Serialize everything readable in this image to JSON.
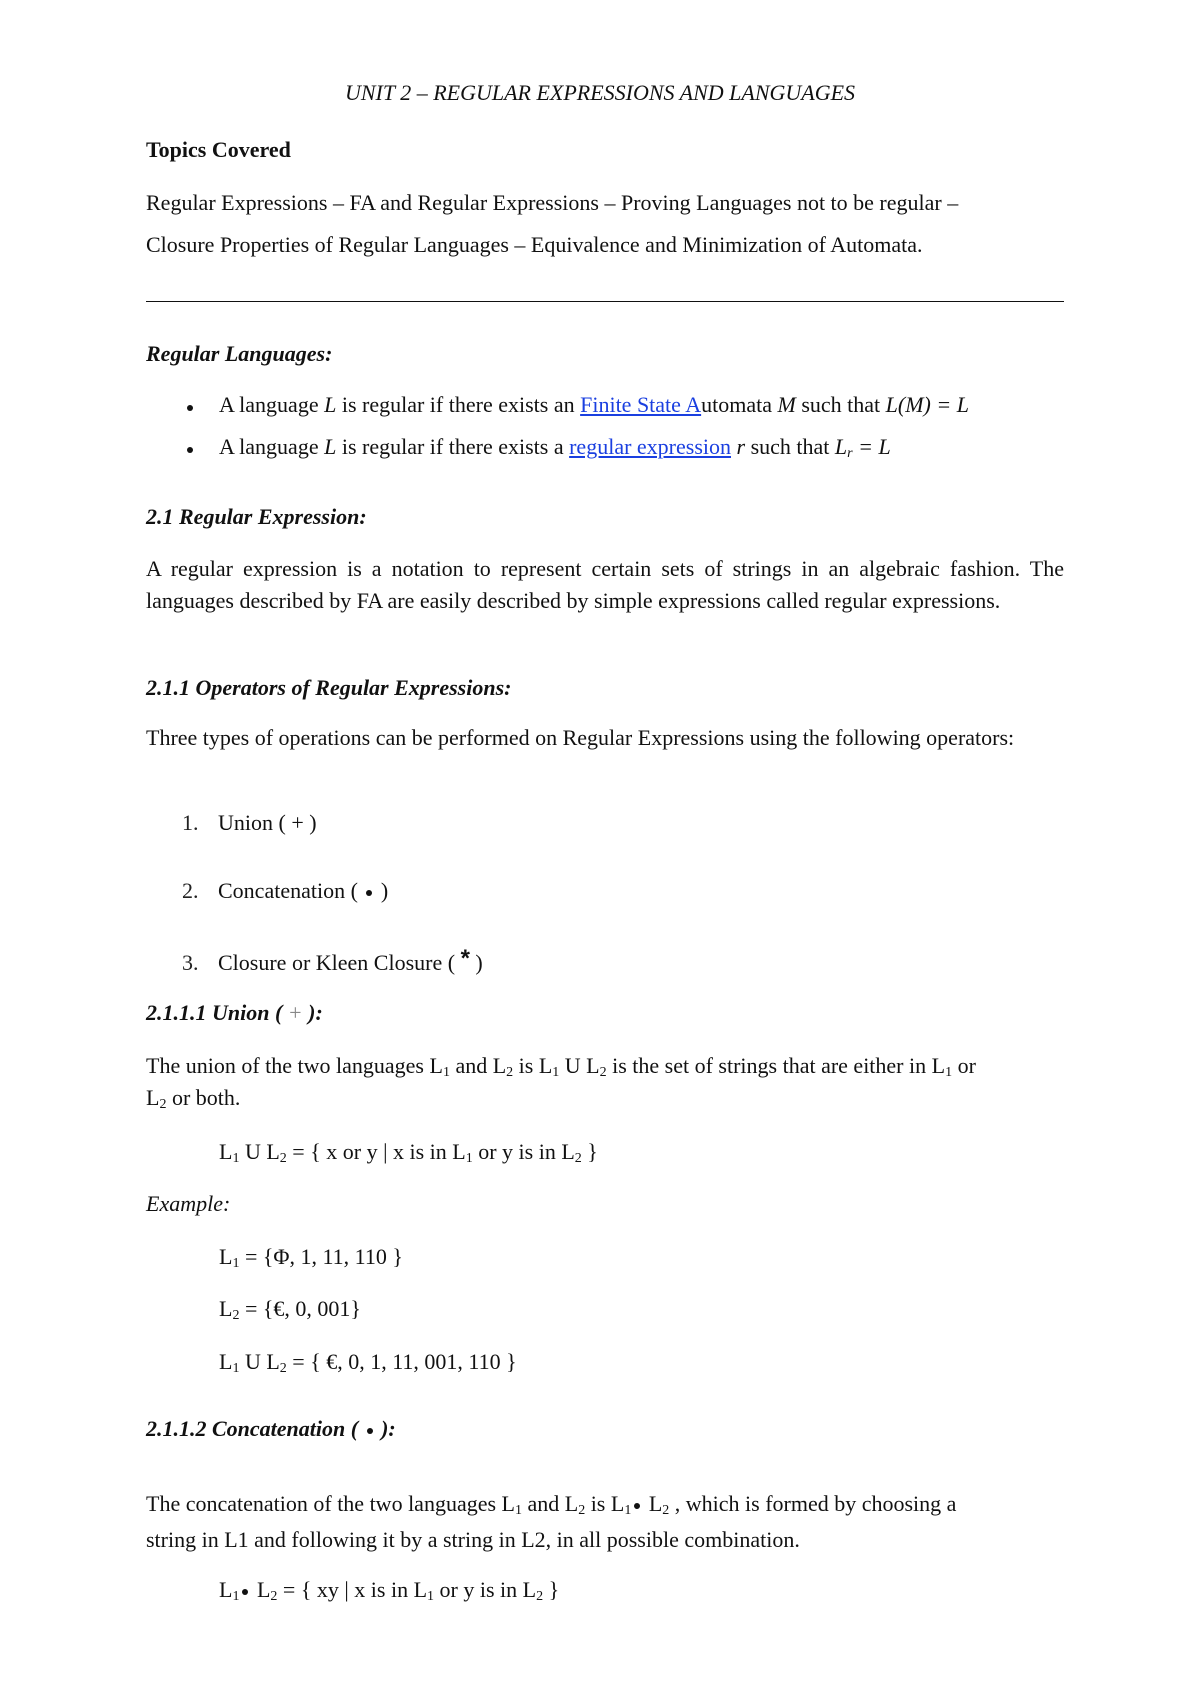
{
  "doc": {
    "title": "UNIT 2 – REGULAR EXPRESSIONS AND LANGUAGES",
    "topics_heading": "Topics Covered",
    "topics_line1": "Regular Expressions – FA and Regular Expressions – Proving Languages not to be regular –",
    "topics_line2": "Closure Properties of Regular Languages – Equivalence and Minimization of Automata.",
    "regular_languages": {
      "heading": "Regular Languages:",
      "bullet1": {
        "pre": "A language ",
        "L": "L",
        "mid": " is regular if there exists an ",
        "link": "Finite State A",
        "post": "utomata ",
        "M": "M",
        "tail": " such that ",
        "formula": "L(M) = L"
      },
      "bullet2": {
        "pre": "A language ",
        "L": "L",
        "mid": " is regular if there exists a ",
        "link": "regular expression",
        "post": " ",
        "r": "r",
        "tail": " such that ",
        "Lr": "L",
        "sub": "r",
        "eq": " = L"
      }
    },
    "section_2_1": {
      "heading": "2.1 Regular Expression:",
      "para": "A regular expression is a notation to represent certain sets of strings in an algebraic fashion. The languages described by FA are easily described by simple expressions called regular expressions."
    },
    "section_2_1_1": {
      "heading": "2.1.1 Operators of Regular Expressions:",
      "para": "Three types of operations can  be performed on Regular Expressions using the following operators:",
      "operators": [
        {
          "num": "1.",
          "label": "Union ( + )"
        },
        {
          "num": "2.",
          "label_pre": "Concatenation (",
          "label_post": ")"
        },
        {
          "num": "3.",
          "label_pre": "Closure or Kleen Closure (",
          "star": "*",
          "label_post": ")"
        }
      ]
    },
    "section_union": {
      "heading_pre": "2.1.1.1 Union (",
      "heading_plus": " + ",
      "heading_post": "):",
      "para_a": "The union of the two languages L",
      "para_b": " and L",
      "para_c": " is L",
      "para_d": " U L",
      "para_e": " is the set of strings that are either in L",
      "para_f": " or",
      "para_line2a": "L",
      "para_line2b": " or both.",
      "formula_a": "L",
      "formula_b": " U L",
      "formula_c": " = { x or y | x is in L",
      "formula_d": " or y is in L",
      "formula_e": " }",
      "example_label": "Example:",
      "ex1_pre": "L",
      "ex1_post": " = {Φ, 1, 11, 110 }",
      "ex2_pre": "L",
      "ex2_post": " = {€, 0, 001}",
      "ex3_a": "L",
      "ex3_b": " U L",
      "ex3_c": " = { €, 0, 1, 11, 001, 110 }",
      "sub1": "1",
      "sub2": "2"
    },
    "section_concat": {
      "heading_pre": "2.1.1.2 Concatenation (",
      "heading_post": "):",
      "para_a": "The concatenation of the two languages L",
      "para_b": " and L",
      "para_c": " is L",
      "para_d": " L",
      "para_e": " , which is formed by choosing a",
      "para_line2": "string in L1 and following it by a string in L2, in all possible combination.",
      "formula_a": "L",
      "formula_b": " L",
      "formula_c": " = { xy | x is in L",
      "formula_d": " or y is in L",
      "formula_e": " }"
    }
  },
  "colors": {
    "link": "#1a3fe0",
    "text": "#111111"
  }
}
